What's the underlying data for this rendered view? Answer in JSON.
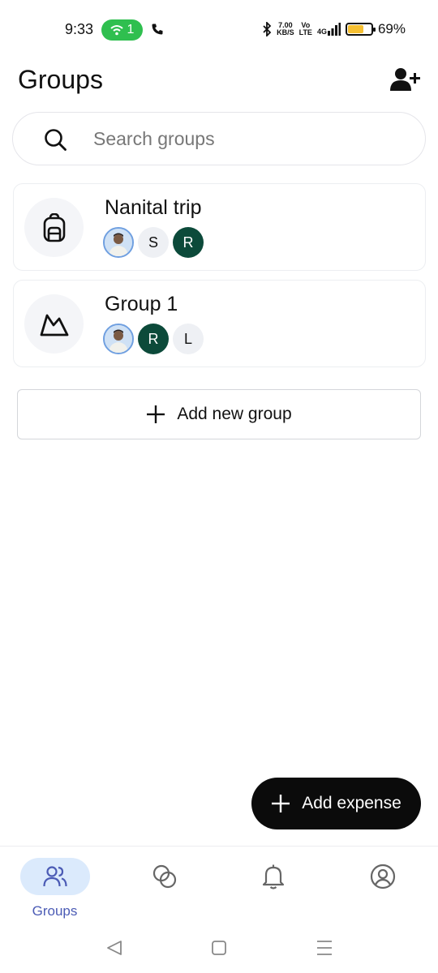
{
  "status_bar": {
    "time": "9:33",
    "hotspot_count": "1",
    "net_speed_value": "7.00",
    "net_speed_unit": "KB/S",
    "volte_top": "Vo",
    "volte_bottom": "LTE",
    "network": "4G",
    "battery_percent": "69%",
    "battery_level": 0.69,
    "colors": {
      "hotspot": "#2fbf4f",
      "battery": "#f6c032"
    }
  },
  "header": {
    "title": "Groups",
    "add_friend_icon": "add-person-icon"
  },
  "search": {
    "placeholder": "Search groups",
    "value": ""
  },
  "groups": [
    {
      "name": "Nanital trip",
      "icon": "backpack-icon",
      "members": [
        {
          "type": "photo",
          "label": ""
        },
        {
          "type": "light",
          "label": "S"
        },
        {
          "type": "dark",
          "label": "R"
        }
      ]
    },
    {
      "name": "Group 1",
      "icon": "mountain-icon",
      "members": [
        {
          "type": "photo",
          "label": ""
        },
        {
          "type": "dark",
          "label": "R"
        },
        {
          "type": "light",
          "label": "L"
        }
      ]
    }
  ],
  "add_group_label": "Add new group",
  "fab_label": "Add expense",
  "bottom_nav": {
    "items": [
      {
        "label": "Groups",
        "icon": "people-icon",
        "active": true
      },
      {
        "label": "",
        "icon": "activity-circles-icon",
        "active": false
      },
      {
        "label": "",
        "icon": "bell-icon",
        "active": false
      },
      {
        "label": "",
        "icon": "account-icon",
        "active": false
      }
    ],
    "active_color": "#dbeafc"
  },
  "accent_colors": {
    "dark_avatar": "#0c4a3a",
    "fab": "#0b0b0b",
    "nav_label": "#4b5bb5"
  }
}
